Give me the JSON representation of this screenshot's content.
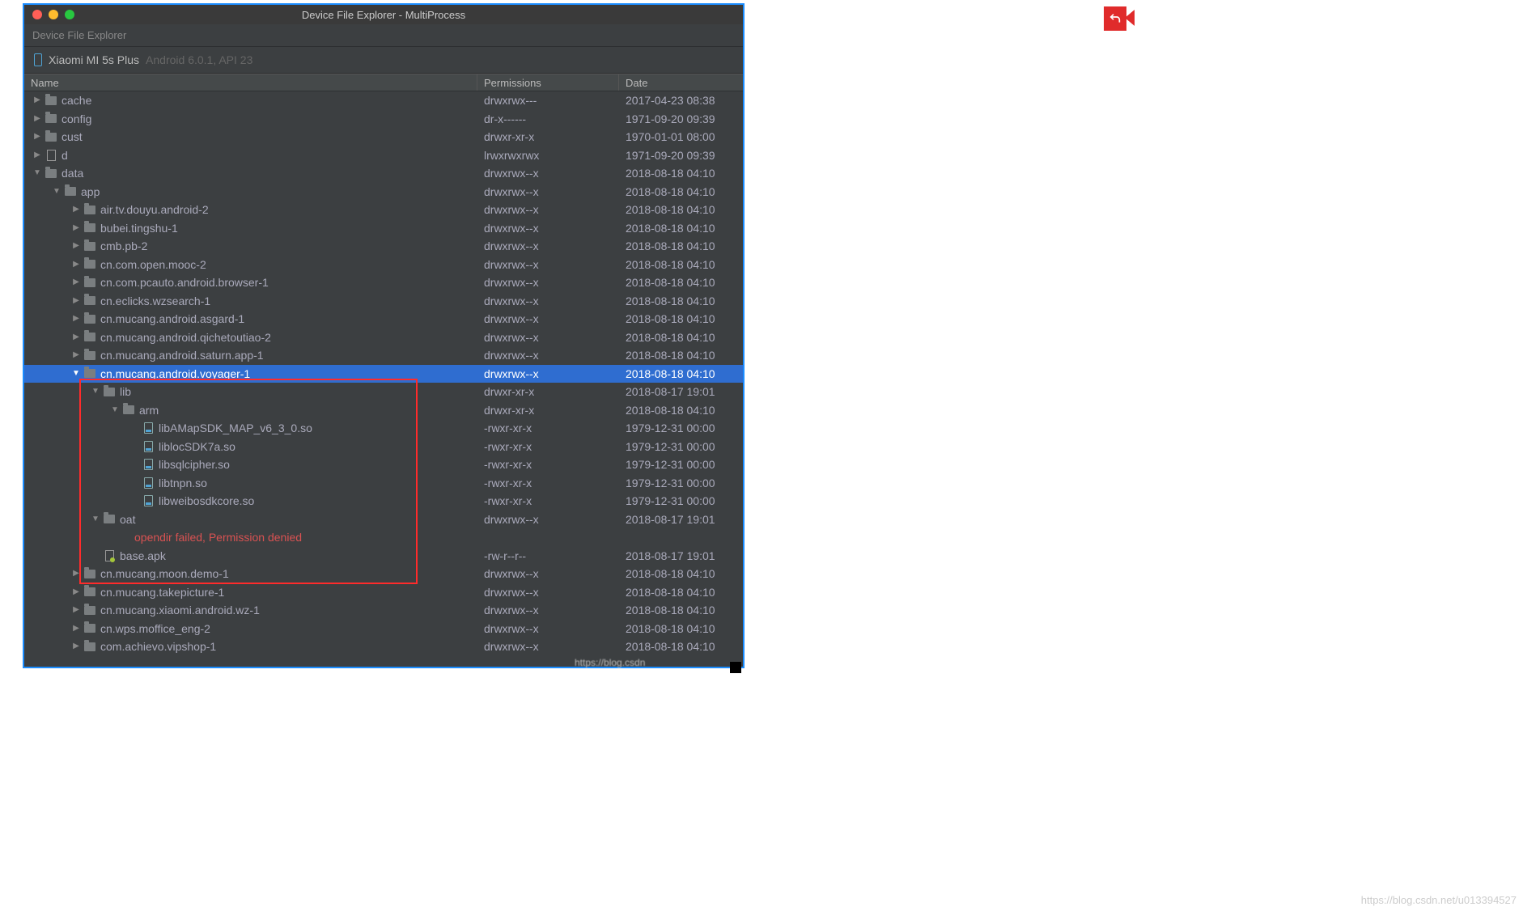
{
  "window": {
    "title": "Device File Explorer - MultiProcess",
    "subtitle": "Device File Explorer"
  },
  "device": {
    "name": "Xiaomi MI 5s Plus",
    "detail": "Android 6.0.1, API 23"
  },
  "columns": {
    "name": "Name",
    "permissions": "Permissions",
    "date": "Date"
  },
  "rows": [
    {
      "depth": 0,
      "expand": "closed",
      "icon": "folder",
      "name": "cache",
      "perm": "drwxrwx---",
      "date": "2017-04-23 08:38"
    },
    {
      "depth": 0,
      "expand": "closed",
      "icon": "folder",
      "name": "config",
      "perm": "dr-x------",
      "date": "1971-09-20 09:39"
    },
    {
      "depth": 0,
      "expand": "closed",
      "icon": "folder",
      "name": "cust",
      "perm": "drwxr-xr-x",
      "date": "1970-01-01 08:00"
    },
    {
      "depth": 0,
      "expand": "closed",
      "icon": "doc",
      "name": "d",
      "perm": "lrwxrwxrwx",
      "date": "1971-09-20 09:39"
    },
    {
      "depth": 0,
      "expand": "open",
      "icon": "folder",
      "name": "data",
      "perm": "drwxrwx--x",
      "date": "2018-08-18 04:10"
    },
    {
      "depth": 1,
      "expand": "open",
      "icon": "folder",
      "name": "app",
      "perm": "drwxrwx--x",
      "date": "2018-08-18 04:10"
    },
    {
      "depth": 2,
      "expand": "closed",
      "icon": "folder",
      "name": "air.tv.douyu.android-2",
      "perm": "drwxrwx--x",
      "date": "2018-08-18 04:10"
    },
    {
      "depth": 2,
      "expand": "closed",
      "icon": "folder",
      "name": "bubei.tingshu-1",
      "perm": "drwxrwx--x",
      "date": "2018-08-18 04:10"
    },
    {
      "depth": 2,
      "expand": "closed",
      "icon": "folder",
      "name": "cmb.pb-2",
      "perm": "drwxrwx--x",
      "date": "2018-08-18 04:10"
    },
    {
      "depth": 2,
      "expand": "closed",
      "icon": "folder",
      "name": "cn.com.open.mooc-2",
      "perm": "drwxrwx--x",
      "date": "2018-08-18 04:10"
    },
    {
      "depth": 2,
      "expand": "closed",
      "icon": "folder",
      "name": "cn.com.pcauto.android.browser-1",
      "perm": "drwxrwx--x",
      "date": "2018-08-18 04:10"
    },
    {
      "depth": 2,
      "expand": "closed",
      "icon": "folder",
      "name": "cn.eclicks.wzsearch-1",
      "perm": "drwxrwx--x",
      "date": "2018-08-18 04:10"
    },
    {
      "depth": 2,
      "expand": "closed",
      "icon": "folder",
      "name": "cn.mucang.android.asgard-1",
      "perm": "drwxrwx--x",
      "date": "2018-08-18 04:10"
    },
    {
      "depth": 2,
      "expand": "closed",
      "icon": "folder",
      "name": "cn.mucang.android.qichetoutiao-2",
      "perm": "drwxrwx--x",
      "date": "2018-08-18 04:10"
    },
    {
      "depth": 2,
      "expand": "closed",
      "icon": "folder",
      "name": "cn.mucang.android.saturn.app-1",
      "perm": "drwxrwx--x",
      "date": "2018-08-18 04:10"
    },
    {
      "depth": 2,
      "expand": "open",
      "icon": "folder",
      "name": "cn.mucang.android.voyager-1",
      "perm": "drwxrwx--x",
      "date": "2018-08-18 04:10",
      "selected": true
    },
    {
      "depth": 3,
      "expand": "open",
      "icon": "folder",
      "name": "lib",
      "perm": "drwxr-xr-x",
      "date": "2018-08-17 19:01"
    },
    {
      "depth": 4,
      "expand": "open",
      "icon": "folder",
      "name": "arm",
      "perm": "drwxr-xr-x",
      "date": "2018-08-18 04:10"
    },
    {
      "depth": 5,
      "expand": "none",
      "icon": "file",
      "name": "libAMapSDK_MAP_v6_3_0.so",
      "perm": "-rwxr-xr-x",
      "date": "1979-12-31 00:00"
    },
    {
      "depth": 5,
      "expand": "none",
      "icon": "file",
      "name": "liblocSDK7a.so",
      "perm": "-rwxr-xr-x",
      "date": "1979-12-31 00:00"
    },
    {
      "depth": 5,
      "expand": "none",
      "icon": "file",
      "name": "libsqlcipher.so",
      "perm": "-rwxr-xr-x",
      "date": "1979-12-31 00:00"
    },
    {
      "depth": 5,
      "expand": "none",
      "icon": "file",
      "name": "libtnpn.so",
      "perm": "-rwxr-xr-x",
      "date": "1979-12-31 00:00"
    },
    {
      "depth": 5,
      "expand": "none",
      "icon": "file",
      "name": "libweibosdkcore.so",
      "perm": "-rwxr-xr-x",
      "date": "1979-12-31 00:00"
    },
    {
      "depth": 3,
      "expand": "open",
      "icon": "folder",
      "name": "oat",
      "perm": "drwxrwx--x",
      "date": "2018-08-17 19:01"
    },
    {
      "depth": 4,
      "expand": "none",
      "icon": "none",
      "name": "opendir failed, Permission denied",
      "perm": "",
      "date": "",
      "error": true
    },
    {
      "depth": 3,
      "expand": "none",
      "icon": "apk",
      "name": "base.apk",
      "perm": "-rw-r--r--",
      "date": "2018-08-17 19:01"
    },
    {
      "depth": 2,
      "expand": "closed",
      "icon": "folder",
      "name": "cn.mucang.moon.demo-1",
      "perm": "drwxrwx--x",
      "date": "2018-08-18 04:10"
    },
    {
      "depth": 2,
      "expand": "closed",
      "icon": "folder",
      "name": "cn.mucang.takepicture-1",
      "perm": "drwxrwx--x",
      "date": "2018-08-18 04:10"
    },
    {
      "depth": 2,
      "expand": "closed",
      "icon": "folder",
      "name": "cn.mucang.xiaomi.android.wz-1",
      "perm": "drwxrwx--x",
      "date": "2018-08-18 04:10"
    },
    {
      "depth": 2,
      "expand": "closed",
      "icon": "folder",
      "name": "cn.wps.moffice_eng-2",
      "perm": "drwxrwx--x",
      "date": "2018-08-18 04:10"
    },
    {
      "depth": 2,
      "expand": "closed",
      "icon": "folder",
      "name": "com.achievo.vipshop-1",
      "perm": "drwxrwx--x",
      "date": "2018-08-18 04:10"
    }
  ],
  "watermarks": {
    "one": "https://blog.csdn",
    "two": "https://blog.csdn.net/u013394527"
  }
}
